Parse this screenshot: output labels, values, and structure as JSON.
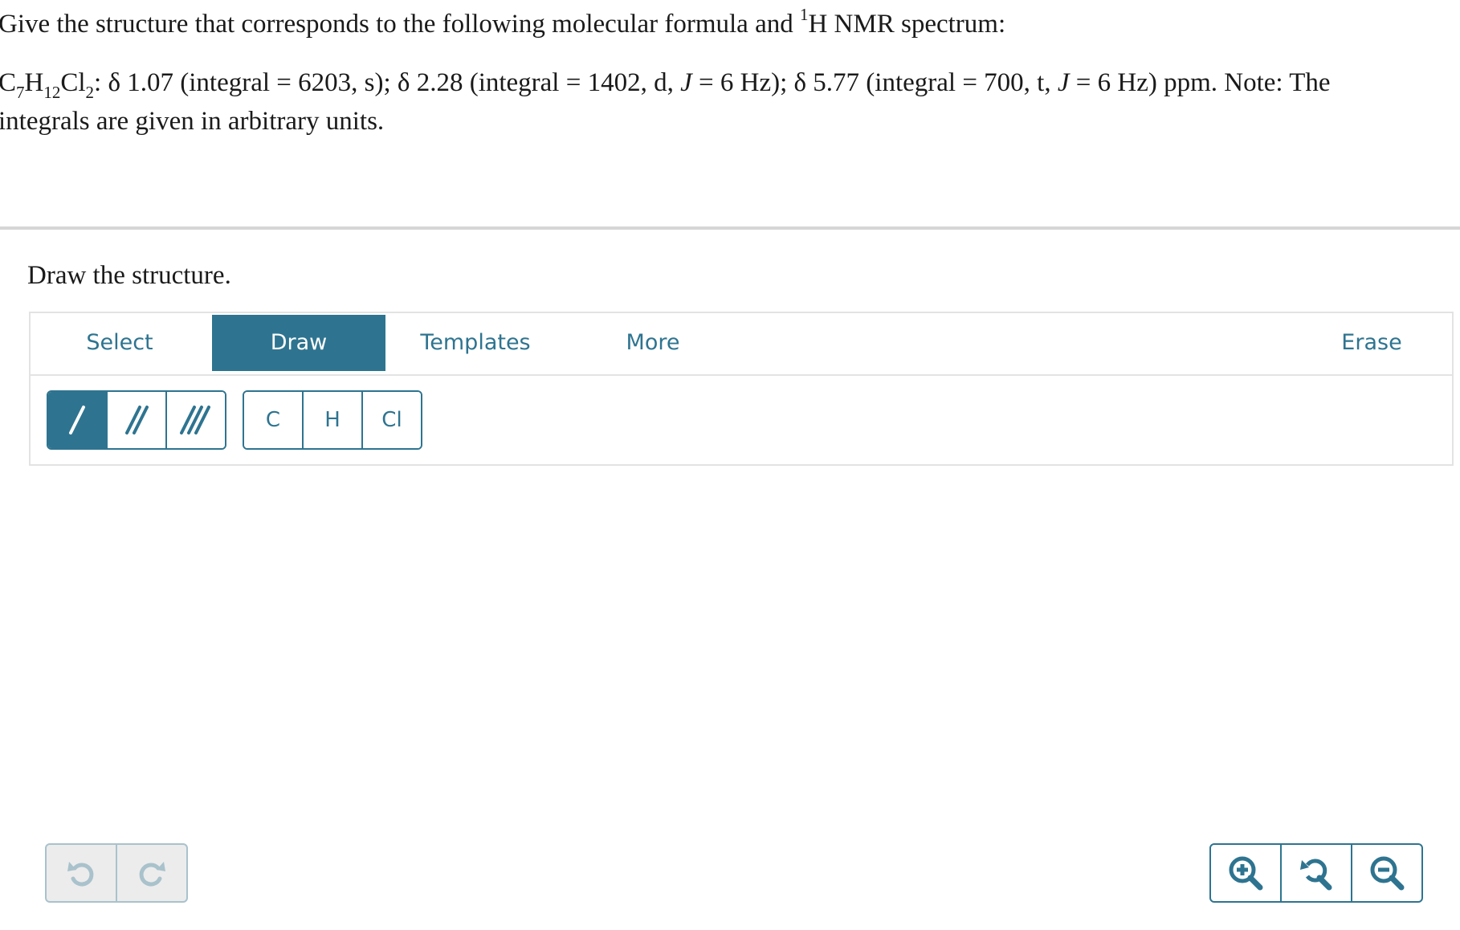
{
  "question": {
    "line1_text": "Give the structure that corresponds to the following molecular formula and ",
    "line1_sup": "1",
    "line1_tail": "H NMR spectrum:",
    "formula": {
      "c": "C",
      "c_sub": "7",
      "h": "H",
      "h_sub": "12",
      "cl": "Cl",
      "cl_sub": "2"
    },
    "data_a": ": δ 1.07 (integral = 6203, s); δ 2.28 (integral = 1402, d, ",
    "j1": "J",
    "data_b": " = 6 Hz); δ 5.77 (integral = 700, t, ",
    "j2": "J",
    "data_c": " = 6 Hz) ppm. Note: The",
    "line3": "integrals are given in arbitrary units."
  },
  "prompt": "Draw the structure.",
  "tabs": [
    {
      "label": "Select",
      "active": false
    },
    {
      "label": "Draw",
      "active": true
    },
    {
      "label": "Templates",
      "active": false
    },
    {
      "label": "More",
      "active": false
    },
    {
      "label": "Erase",
      "active": false
    }
  ],
  "bond_tools": [
    {
      "name": "single-bond",
      "active": true
    },
    {
      "name": "double-bond",
      "active": false
    },
    {
      "name": "triple-bond",
      "active": false
    }
  ],
  "atoms": [
    "C",
    "H",
    "Cl"
  ],
  "history": {
    "undo_icon": "undo-icon",
    "redo_icon": "redo-icon"
  },
  "zoom": {
    "in_icon": "zoom-in-icon",
    "reset_icon": "zoom-reset-icon",
    "out_icon": "zoom-out-icon"
  },
  "colors": {
    "accent": "#2e7490",
    "disabled_border": "#a9c2cc",
    "divider": "#d6d6d6"
  }
}
